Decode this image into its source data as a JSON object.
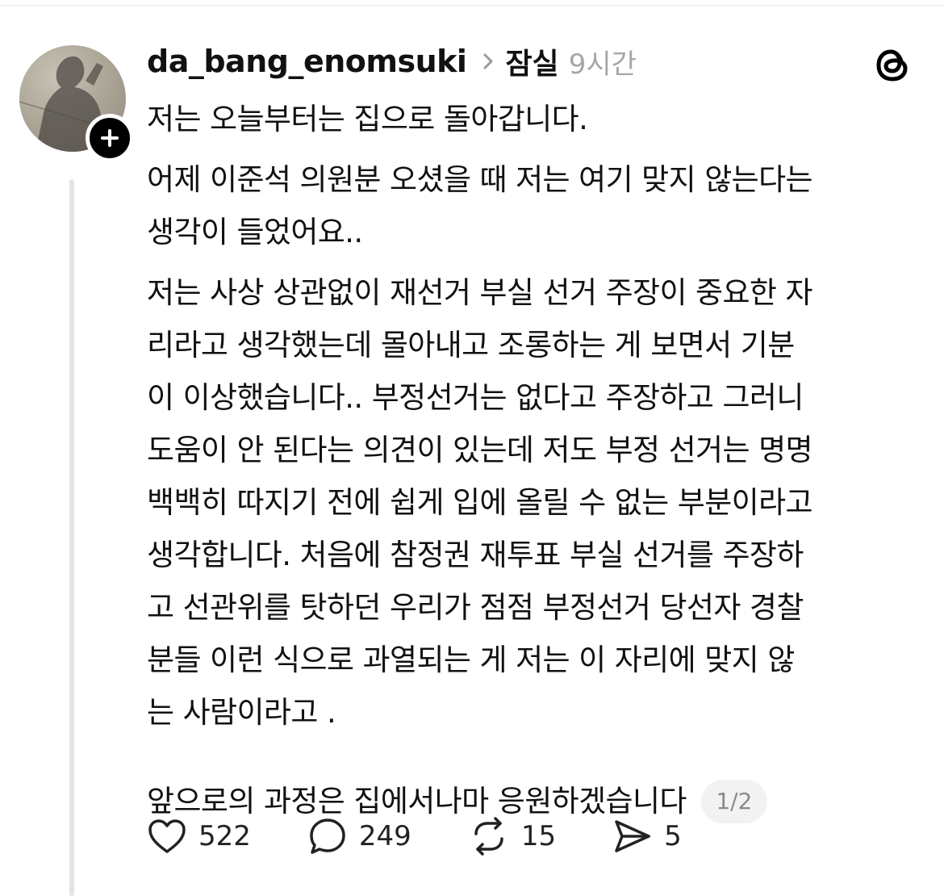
{
  "post": {
    "author": {
      "username": "da_bang_enomsuki",
      "avatar_icon": "avatar-photo",
      "follow_icon": "plus-icon"
    },
    "community": "잠실",
    "time_ago": "9시간",
    "app_logo_icon": "threads-logo-icon",
    "lines": [
      "저는 오늘부터는 집으로 돌아갑니다.",
      "어제 이준석 의원분 오셨을 때 저는 여기 맞지 않는다는",
      "생각이 들었어요..",
      "저는 사상 상관없이 재선거 부실 선거 주장이 중요한 자",
      "리라고 생각했는데 몰아내고 조롱하는 게 보면서 기분",
      "이 이상했습니다.. 부정선거는 없다고 주장하고 그러니",
      "도움이 안 된다는 의견이 있는데 저도 부정 선거는 명명",
      "백백히 따지기 전에 쉽게 입에 올릴 수 없는 부분이라고",
      "생각합니다. 처음에 참정권 재투표 부실 선거를 주장하",
      "고 선관위를 탓하던 우리가 점점 부정선거 당선자 경찰",
      "분들 이런 식으로 과열되는 게 저는 이 자리에 맞지 않",
      "는 사람이라고 ."
    ],
    "last_line": "앞으로의 과정은 집에서나마 응원하겠습니다",
    "page_indicator": "1/2",
    "actions": {
      "likes": "522",
      "replies": "249",
      "reposts": "15",
      "shares": "5"
    }
  }
}
